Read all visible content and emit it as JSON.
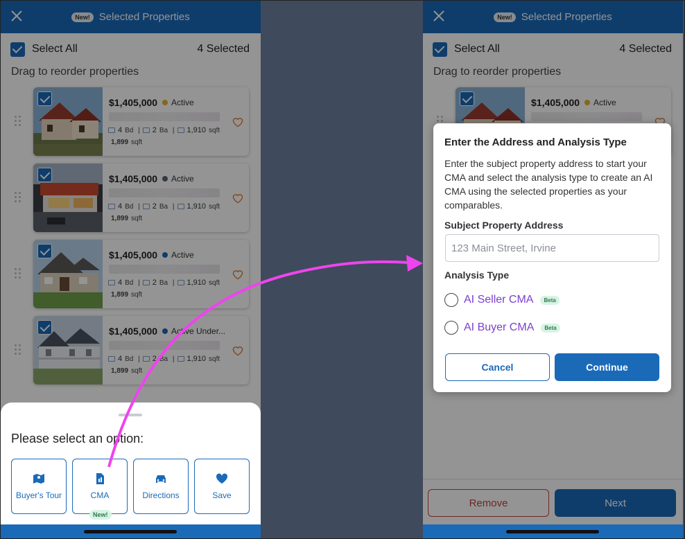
{
  "header": {
    "new_badge": "New!",
    "title": "Selected Properties"
  },
  "select_all": {
    "label": "Select All",
    "count": "4 Selected"
  },
  "hint": "Drag to reorder properties",
  "listings": [
    {
      "price": "$1,405,000",
      "status": "Active",
      "status_color": "#e3b12a",
      "beds": "4",
      "beds_unit": "Bd",
      "baths": "2",
      "baths_unit": "Ba",
      "area": "1,910",
      "area_unit": "sqft",
      "lot": "1,899",
      "lot_unit": "sqft"
    },
    {
      "price": "$1,405,000",
      "status": "Active",
      "status_color": "#5a6270",
      "beds": "4",
      "beds_unit": "Bd",
      "baths": "2",
      "baths_unit": "Ba",
      "area": "1,910",
      "area_unit": "sqft",
      "lot": "1,899",
      "lot_unit": "sqft"
    },
    {
      "price": "$1,405,000",
      "status": "Active",
      "status_color": "#1a6ab8",
      "beds": "4",
      "beds_unit": "Bd",
      "baths": "2",
      "baths_unit": "Ba",
      "area": "1,910",
      "area_unit": "sqft",
      "lot": "1,899",
      "lot_unit": "sqft"
    },
    {
      "price": "$1,405,000",
      "status": "Active Under...",
      "status_color": "#1a6ab8",
      "beds": "4",
      "beds_unit": "Bd",
      "baths": "2",
      "baths_unit": "Ba",
      "area": "1,910",
      "area_unit": "sqft",
      "lot": "1,899",
      "lot_unit": "sqft"
    }
  ],
  "sheet": {
    "question": "Please select an option:",
    "options": [
      {
        "label": "Buyer's Tour",
        "icon": "map-icon"
      },
      {
        "label": "CMA",
        "icon": "document-icon"
      },
      {
        "label": "Directions",
        "icon": "car-icon"
      },
      {
        "label": "Save",
        "icon": "heart-icon"
      }
    ],
    "new_tag": "New!"
  },
  "modal": {
    "title": "Enter the Address and Analysis Type",
    "description": "Enter the subject property address to start your CMA and select the analysis type to create an AI CMA using the selected properties as your comparables.",
    "address_label": "Subject Property Address",
    "address_placeholder": "123 Main Street, Irvine",
    "analysis_label": "Analysis Type",
    "options": [
      {
        "label": "AI Seller CMA",
        "badge": "Beta"
      },
      {
        "label": "AI Buyer CMA",
        "badge": "Beta"
      }
    ],
    "cancel": "Cancel",
    "continue": "Continue"
  },
  "footer": {
    "remove": "Remove",
    "next": "Next"
  },
  "colors": {
    "primary": "#1a6ab8",
    "accent_purple": "#7c3fd0",
    "remove_red": "#c2423a",
    "annotation_arrow": "#ee44ee"
  }
}
